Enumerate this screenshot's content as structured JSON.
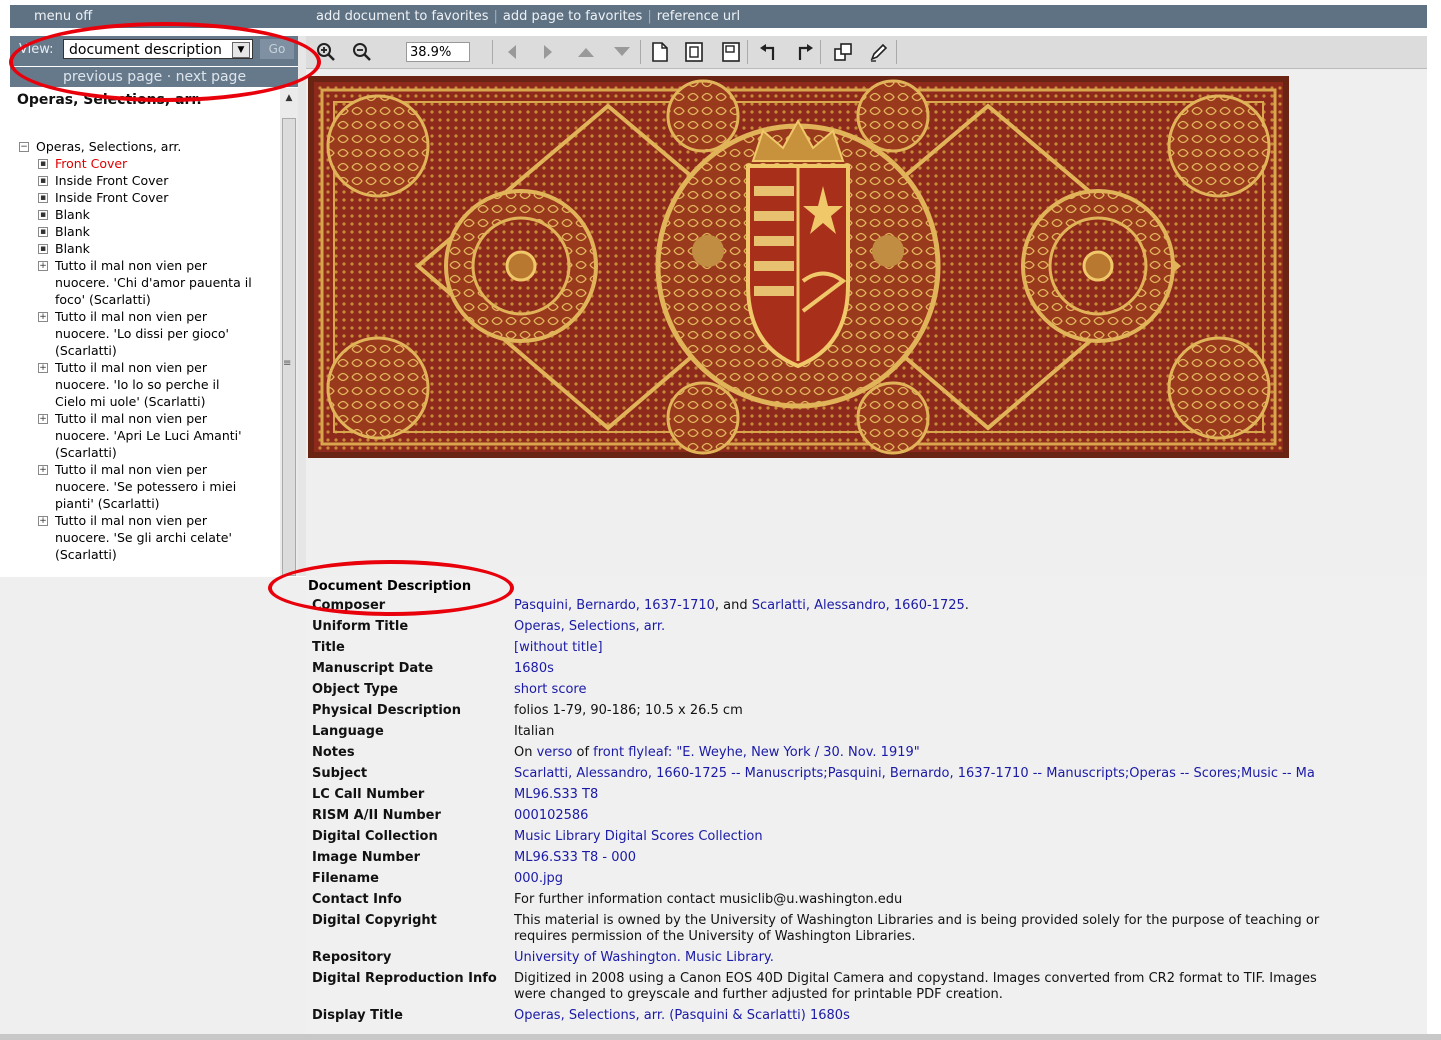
{
  "topbar": {
    "menu_off": "menu off",
    "add_document": "add document to favorites",
    "add_page": "add page to favorites",
    "reference_url": "reference url"
  },
  "view_control": {
    "label": "View:",
    "selected": "document description",
    "go": "Go",
    "nav_text": "previous page · next page"
  },
  "viewer": {
    "zoom": "38.9%"
  },
  "tree": {
    "heading": "Operas, Selections, arr.",
    "root": "Operas, Selections, arr.",
    "items": [
      {
        "lines": [
          "Front Cover"
        ],
        "current": true
      },
      {
        "lines": [
          "Inside Front Cover"
        ]
      },
      {
        "lines": [
          "Inside Front Cover"
        ]
      },
      {
        "lines": [
          "Blank"
        ]
      },
      {
        "lines": [
          "Blank"
        ]
      },
      {
        "lines": [
          "Blank"
        ]
      },
      {
        "lines": [
          "Tutto il mal non vien per",
          "nuocere. 'Chi d'amor pauenta il",
          "foco' (Scarlatti)"
        ],
        "expand": true
      },
      {
        "lines": [
          "Tutto il mal non vien per",
          "nuocere. 'Lo dissi per gioco'",
          "(Scarlatti)"
        ],
        "expand": true
      },
      {
        "lines": [
          "Tutto il mal non vien per",
          "nuocere. 'Io lo so perche il",
          "Cielo mi uole' (Scarlatti)"
        ],
        "expand": true
      },
      {
        "lines": [
          "Tutto il mal non vien per",
          "nuocere. 'Apri Le Luci Amanti'",
          "(Scarlatti)"
        ],
        "expand": true
      },
      {
        "lines": [
          "Tutto il mal non vien per",
          "nuocere. 'Se potessero i miei",
          "pianti' (Scarlatti)"
        ],
        "expand": true
      },
      {
        "lines": [
          "Tutto il mal non vien per",
          "nuocere. 'Se gli archi celate'",
          "(Scarlatti)"
        ],
        "expand": true
      }
    ]
  },
  "description": {
    "title": "Document Description",
    "rows": [
      {
        "key": "Composer",
        "parts": [
          {
            "t": "Pasquini, Bernardo, 1637-1710",
            "link": true
          },
          {
            "t": ", and "
          },
          {
            "t": "Scarlatti, Alessandro, 1660-1725",
            "link": true
          },
          {
            "t": "."
          }
        ]
      },
      {
        "key": "Uniform Title",
        "parts": [
          {
            "t": "Operas, Selections, arr.",
            "link": true
          }
        ]
      },
      {
        "key": "Title",
        "parts": [
          {
            "t": "[without title]",
            "link": true
          }
        ]
      },
      {
        "key": "Manuscript Date",
        "parts": [
          {
            "t": "1680s",
            "link": true
          }
        ]
      },
      {
        "key": "Object Type",
        "parts": [
          {
            "t": "short score",
            "link": true
          }
        ]
      },
      {
        "key": "Physical Description",
        "parts": [
          {
            "t": "folios 1-79, 90-186; 10.5 x 26.5 cm"
          }
        ]
      },
      {
        "key": "Language",
        "parts": [
          {
            "t": "Italian"
          }
        ]
      },
      {
        "key": "Notes",
        "parts": [
          {
            "t": "On "
          },
          {
            "t": "verso",
            "link": true
          },
          {
            "t": " of "
          },
          {
            "t": "front flyleaf",
            "link": true
          },
          {
            "t": ": \"E. Weyhe, New York / 30. Nov. 1919\"",
            "link": true
          }
        ]
      },
      {
        "key": "Subject",
        "parts": [
          {
            "t": "Scarlatti, Alessandro, 1660-1725 -- Manuscripts;Pasquini, Bernardo, 1637-1710 -- Manuscripts;Operas -- Scores;Music -- Ma",
            "link": true
          }
        ]
      },
      {
        "key": "LC Call Number",
        "parts": [
          {
            "t": "ML96.S33 T8",
            "link": true
          }
        ]
      },
      {
        "key": "RISM A/II Number",
        "parts": [
          {
            "t": "000102586",
            "link": true
          }
        ]
      },
      {
        "key": "Digital Collection",
        "parts": [
          {
            "t": "Music Library Digital Scores Collection",
            "link": true
          }
        ]
      },
      {
        "key": "Image Number",
        "parts": [
          {
            "t": "ML96.S33 T8 - 000",
            "link": true
          }
        ]
      },
      {
        "key": "Filename",
        "parts": [
          {
            "t": "000.jpg",
            "link": true
          }
        ]
      },
      {
        "key": "Contact Info",
        "parts": [
          {
            "t": "For further information contact musiclib@u.washington.edu"
          }
        ]
      },
      {
        "key": "Digital Copyright",
        "parts": [
          {
            "t": "This material is owned by the University of Washington Libraries and is being provided solely for the purpose of teaching or"
          }
        ],
        "line2": "requires permission of the University of Washington Libraries."
      },
      {
        "key": "Repository",
        "parts": [
          {
            "t": "University of Washington. Music Library.",
            "link": true
          }
        ]
      },
      {
        "key": "Digital Reproduction Info",
        "parts": [
          {
            "t": "Digitized in 2008 using a Canon EOS 40D Digital Camera and copystand. Images converted from CR2 format to TIF. Images"
          }
        ],
        "line2": "were changed to greyscale and further adjusted for printable PDF creation."
      },
      {
        "key": "Display Title",
        "parts": [
          {
            "t": "Operas, Selections, arr. (Pasquini & Scarlatti) 1680s",
            "link": true
          }
        ]
      }
    ]
  },
  "colors": {
    "header": "#5f7283",
    "link": "#1a1aa6",
    "current_item": "#e00000",
    "annotation": "#e8000b"
  }
}
